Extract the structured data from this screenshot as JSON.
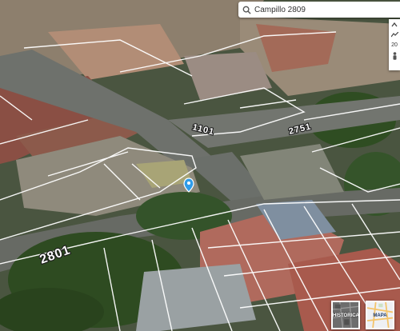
{
  "search": {
    "value": "Campillo 2809",
    "placeholder": ""
  },
  "street_labels": [
    "2801",
    "1101",
    "2751"
  ],
  "controls": {
    "zoom_level": "20"
  },
  "layers": [
    {
      "label": "HISTORICA"
    },
    {
      "label": "MAPA"
    }
  ],
  "colors": {
    "accent": "#2f9ce9",
    "label_fill": "#ffffff",
    "lot_line": "#ffffff"
  },
  "icons": {
    "search": "search-icon",
    "pin": "location-pin-icon",
    "pan": "chevron-up-icon",
    "tilt": "tilt-icon",
    "person": "person-icon"
  }
}
